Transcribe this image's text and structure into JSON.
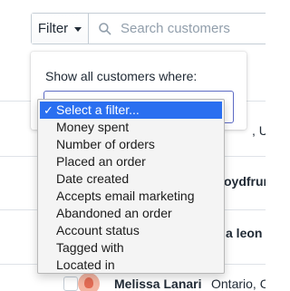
{
  "toolbar": {
    "filter_label": "Filter",
    "search_placeholder": "Search customers"
  },
  "popover": {
    "label": "Show all customers where:"
  },
  "filter_select": {
    "options": [
      "Select a filter...",
      "Money spent",
      "Number of orders",
      "Placed an order",
      "Date created",
      "Accepts email marketing",
      "Abandoned an order",
      "Account status",
      "Tagged with",
      "Located in"
    ],
    "selected_index": 0
  },
  "background_rows": {
    "r1_location_fragment": ", U",
    "r2_name_fragment": "oydfrun",
    "r3_name_fragment": "a leon",
    "r4_name": "Melissa Lanari",
    "r4_location": "Ontario, C"
  },
  "colors": {
    "accent": "#5c6ac4",
    "selected_option": "#2a6ff0",
    "border": "#c4cdd5"
  }
}
